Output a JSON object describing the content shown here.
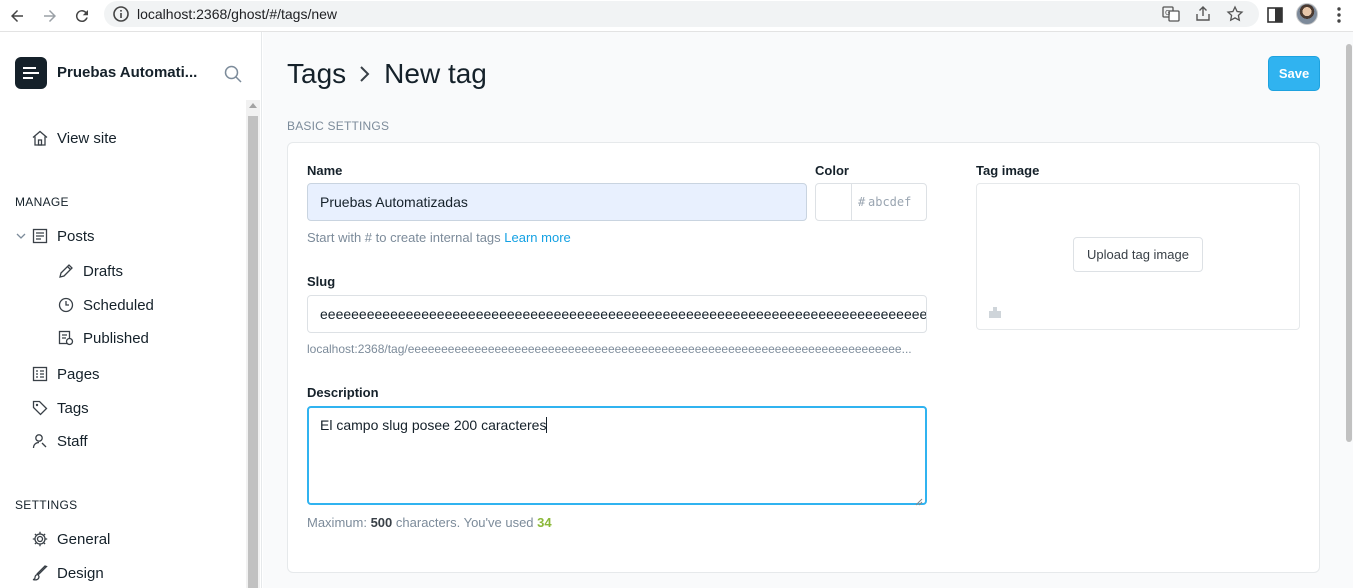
{
  "browser": {
    "url": "localhost:2368/ghost/#/tags/new"
  },
  "sidebar": {
    "site_title": "Pruebas Automati...",
    "view_site": "View site",
    "manage_label": "MANAGE",
    "items": [
      {
        "label": "Posts"
      },
      {
        "label": "Drafts"
      },
      {
        "label": "Scheduled"
      },
      {
        "label": "Published"
      },
      {
        "label": "Pages"
      },
      {
        "label": "Tags"
      },
      {
        "label": "Staff"
      }
    ],
    "settings_label": "SETTINGS",
    "settings_items": [
      {
        "label": "General"
      },
      {
        "label": "Design"
      }
    ]
  },
  "header": {
    "breadcrumb_parent": "Tags",
    "breadcrumb_current": "New tag",
    "save_label": "Save"
  },
  "form": {
    "section_label": "BASIC SETTINGS",
    "name_label": "Name",
    "name_value": "Pruebas Automatizadas",
    "name_hint": "Start with # to create internal tags",
    "name_hint_link": "Learn more",
    "color_label": "Color",
    "color_hash": "#",
    "color_placeholder": "abcdef",
    "slug_label": "Slug",
    "slug_value": "eeeeeeeeeeeeeeeeeeeeeeeeeeeeeeeeeeeeeeeeeeeeeeeeeeeeeeeeeeeeeeeeeeeeeeeeeeeeee",
    "slug_url": "localhost:2368/tag/eeeeeeeeeeeeeeeeeeeeeeeeeeeeeeeeeeeeeeeeeeeeeeeeeeeeeeeeeeeeeeeeeeeeeeeeee...",
    "description_label": "Description",
    "description_value": "El campo slug posee 200 caracteres",
    "desc_max_prefix": "Maximum:",
    "desc_max_value": "500",
    "desc_max_mid": "characters. You've used",
    "desc_used": "34",
    "tag_image_label": "Tag image",
    "upload_label": "Upload tag image"
  },
  "colors": {
    "accent": "#30b3f0",
    "link": "#14a1e3",
    "used_count": "#8bb839"
  }
}
